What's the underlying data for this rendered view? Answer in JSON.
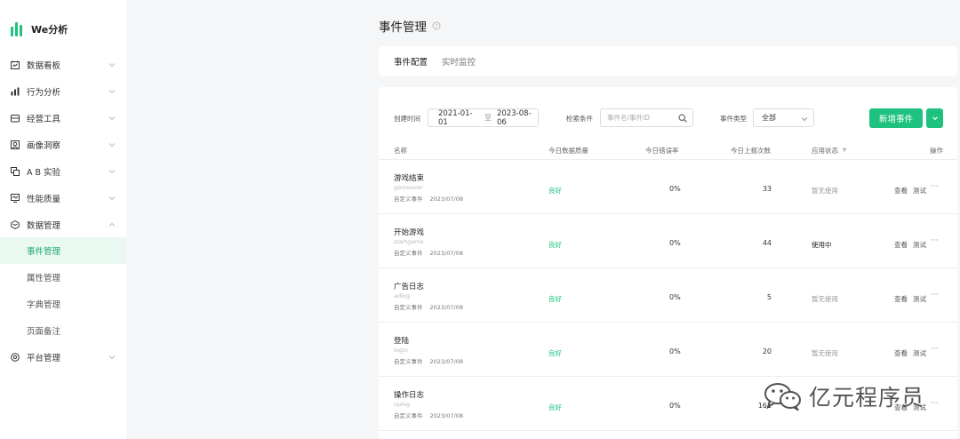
{
  "app": {
    "name": "We分析",
    "brand_color": "#1fc17e"
  },
  "sidebar": {
    "items": [
      {
        "label": "数据看板",
        "icon": "dashboard-icon"
      },
      {
        "label": "行为分析",
        "icon": "bar-chart-icon"
      },
      {
        "label": "经营工具",
        "icon": "toolbox-icon"
      },
      {
        "label": "画像洞察",
        "icon": "portrait-icon"
      },
      {
        "label": "A B 实验",
        "icon": "ab-test-icon"
      },
      {
        "label": "性能质量",
        "icon": "performance-icon"
      },
      {
        "label": "数据管理",
        "icon": "data-manage-icon",
        "expanded": true
      },
      {
        "label": "平台管理",
        "icon": "platform-settings-icon"
      }
    ],
    "sub_items": [
      {
        "label": "事件管理",
        "active": true
      },
      {
        "label": "属性管理"
      },
      {
        "label": "字典管理"
      },
      {
        "label": "页面备注"
      }
    ]
  },
  "page": {
    "title": "事件管理"
  },
  "tabs": [
    {
      "label": "事件配置",
      "active": true
    },
    {
      "label": "实时监控"
    }
  ],
  "filters": {
    "created_label": "创建时间",
    "date_start": "2021-01-01",
    "date_sep": "至",
    "date_end": "2023-08-06",
    "search_label": "检索条件",
    "search_placeholder": "事件名/事件ID",
    "type_label": "事件类型",
    "type_value": "全部",
    "add_button": "新增事件"
  },
  "table": {
    "headers": {
      "name": "名称",
      "quality": "今日数据质量",
      "error_rate": "今日错误率",
      "reports": "今日上报次数",
      "status": "应用状态",
      "actions": "操作"
    },
    "action_view": "查看",
    "action_test": "测试",
    "action_more": "···",
    "rows": [
      {
        "name": "游戏结束",
        "key": "gameover",
        "type": "自定义事件",
        "date": "2023/07/08",
        "quality": "良好",
        "error_rate": "0%",
        "reports": "33",
        "status": "暂无使用"
      },
      {
        "name": "开始游戏",
        "key": "startgame",
        "type": "自定义事件",
        "date": "2023/07/08",
        "quality": "良好",
        "error_rate": "0%",
        "reports": "44",
        "status": "使用中"
      },
      {
        "name": "广告日志",
        "key": "adlog",
        "type": "自定义事件",
        "date": "2023/07/08",
        "quality": "良好",
        "error_rate": "0%",
        "reports": "5",
        "status": "暂无使用"
      },
      {
        "name": "登陆",
        "key": "login",
        "type": "自定义事件",
        "date": "2023/07/08",
        "quality": "良好",
        "error_rate": "0%",
        "reports": "20",
        "status": "暂无使用"
      },
      {
        "name": "操作日志",
        "key": "oplog",
        "type": "自定义事件",
        "date": "2023/07/08",
        "quality": "良好",
        "error_rate": "0%",
        "reports": "161",
        "status": ""
      }
    ]
  },
  "watermark": {
    "text": "亿元程序员",
    "icon": "wechat-icon"
  }
}
